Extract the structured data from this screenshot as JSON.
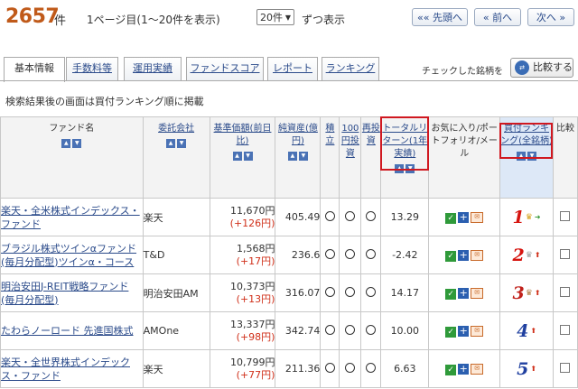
{
  "header": {
    "count": "2657",
    "count_unit": "件",
    "page_info": "1ページ目(1〜20件を表示)",
    "per_page": "20件",
    "per_page_suffix": "ずつ表示",
    "btn_first": "«« 先頭へ",
    "btn_prev": "« 前へ",
    "btn_next": "次へ »"
  },
  "tabs": [
    {
      "label": "基本情報"
    },
    {
      "label": "手数料等"
    },
    {
      "label": "運用実績"
    },
    {
      "label": "ファンドスコア"
    },
    {
      "label": "レポート"
    },
    {
      "label": "ランキング"
    }
  ],
  "compare": {
    "label": "チェックした銘柄を",
    "button": "比較する",
    "icon": "compare-icon"
  },
  "notice": "検索結果後の画面は買付ランキング順に掲載",
  "columns": {
    "fund_name": "ファンド名",
    "company": "委託会社",
    "nav": "基準価額(前日比)",
    "assets": "純資産(億円)",
    "tsumitate": "積立",
    "yen100": "100円投資",
    "reinvest": "再投資",
    "total_return": "トータルリターン(1年実績)",
    "favorites": "お気に入り/ポートフォリオ/メール",
    "rank": "買付ランキング(全銘柄)",
    "compare": "比較"
  },
  "rows": [
    {
      "name": "楽天・全米株式インデックス・ファンド",
      "company": "楽天",
      "price": "11,670円",
      "change": "(+126円)",
      "assets": "405.49",
      "ret": "13.29",
      "rank": "1",
      "crown": "gold-crown-icon",
      "trend": "flat-arrow-icon"
    },
    {
      "name": "ブラジル株式ツインαファンド(毎月分配型)ツインα・コース",
      "company": "T&D",
      "price": "1,568円",
      "change": "(+17円)",
      "assets": "236.6",
      "ret": "-2.42",
      "rank": "2",
      "crown": "silver-crown-icon",
      "trend": "up-arrow-icon"
    },
    {
      "name": "明治安田J-REIT戦略ファンド(毎月分配型)",
      "company": "明治安田AM",
      "price": "10,373円",
      "change": "(+13円)",
      "assets": "316.07",
      "ret": "14.17",
      "rank": "3",
      "crown": "bronze-crown-icon",
      "trend": "up-arrow-icon"
    },
    {
      "name": "たわらノーロード 先進国株式",
      "company": "AMOne",
      "price": "13,337円",
      "change": "(+98円)",
      "assets": "342.74",
      "ret": "10.00",
      "rank": "4",
      "crown": "",
      "trend": "up-arrow-icon"
    },
    {
      "name": "楽天・全世界株式インデックス・ファンド",
      "company": "楽天",
      "price": "10,799円",
      "change": "(+77円)",
      "assets": "211.36",
      "ret": "6.63",
      "rank": "5",
      "crown": "",
      "trend": "up-arrow-icon"
    }
  ],
  "colors": {
    "accent": "#c05a1a",
    "link": "#2a4a8a",
    "highlight": "#d01820",
    "rank_top": "#d6140f",
    "rank_other": "#2040a0"
  }
}
